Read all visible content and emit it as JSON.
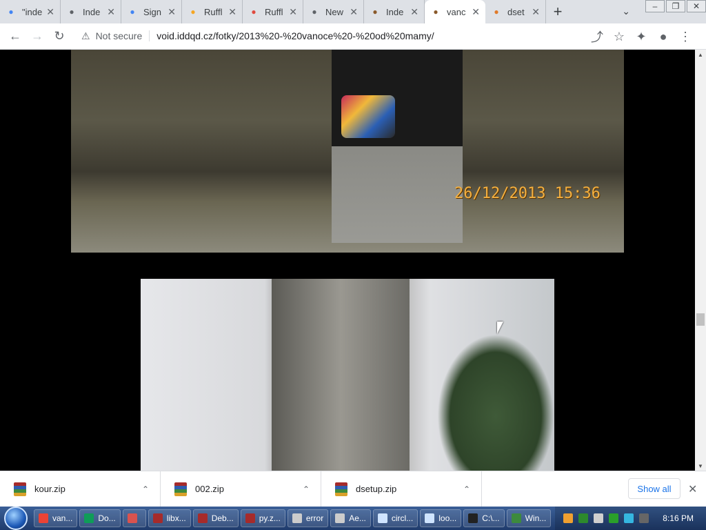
{
  "tabs": [
    {
      "label": "\"inde",
      "icon": "google-icon",
      "color": "#4285f4"
    },
    {
      "label": "Inde",
      "icon": "globe-icon",
      "color": "#5f6368"
    },
    {
      "label": "Sign",
      "icon": "google-icon",
      "color": "#4285f4"
    },
    {
      "label": "Ruffl",
      "icon": "ruffle-icon",
      "color": "#f5a623"
    },
    {
      "label": "Ruffl",
      "icon": "ruffle-icon",
      "color": "#e04a3f"
    },
    {
      "label": "New",
      "icon": "chrome-icon",
      "color": "#5f6368"
    },
    {
      "label": "Inde",
      "icon": "photo-icon",
      "color": "#8a5a2b"
    },
    {
      "label": "vanc",
      "icon": "photo-icon",
      "color": "#8a5a2b",
      "active": true
    },
    {
      "label": "dset",
      "icon": "gear-icon",
      "color": "#e07a2a"
    }
  ],
  "toolbar": {
    "security_label": "Not secure",
    "url": "void.iddqd.cz/fotky/2013%20-%20vanoce%20-%20od%20mamy/"
  },
  "photo1": {
    "timestamp": "26/12/2013 15:36"
  },
  "downloads": {
    "items": [
      {
        "name": "kour.zip"
      },
      {
        "name": "002.zip"
      },
      {
        "name": "dsetup.zip"
      }
    ],
    "show_all": "Show all"
  },
  "taskbar": {
    "items": [
      {
        "label": "van...",
        "color": "#ea4335"
      },
      {
        "label": "Do...",
        "color": "#0f9d58"
      },
      {
        "label": "",
        "color": "#d9534f"
      },
      {
        "label": "libx...",
        "color": "#a62b2b"
      },
      {
        "label": "Deb...",
        "color": "#a62b2b"
      },
      {
        "label": "py.z...",
        "color": "#a62b2b"
      },
      {
        "label": "error",
        "color": "#cccccc"
      },
      {
        "label": "Ae...",
        "color": "#cccccc"
      },
      {
        "label": "circl...",
        "color": "#cfe4ff"
      },
      {
        "label": "loo...",
        "color": "#cfe4ff"
      },
      {
        "label": "C:\\...",
        "color": "#222222"
      },
      {
        "label": "Win...",
        "color": "#3d8a3d"
      }
    ],
    "time": "8:16 PM"
  }
}
